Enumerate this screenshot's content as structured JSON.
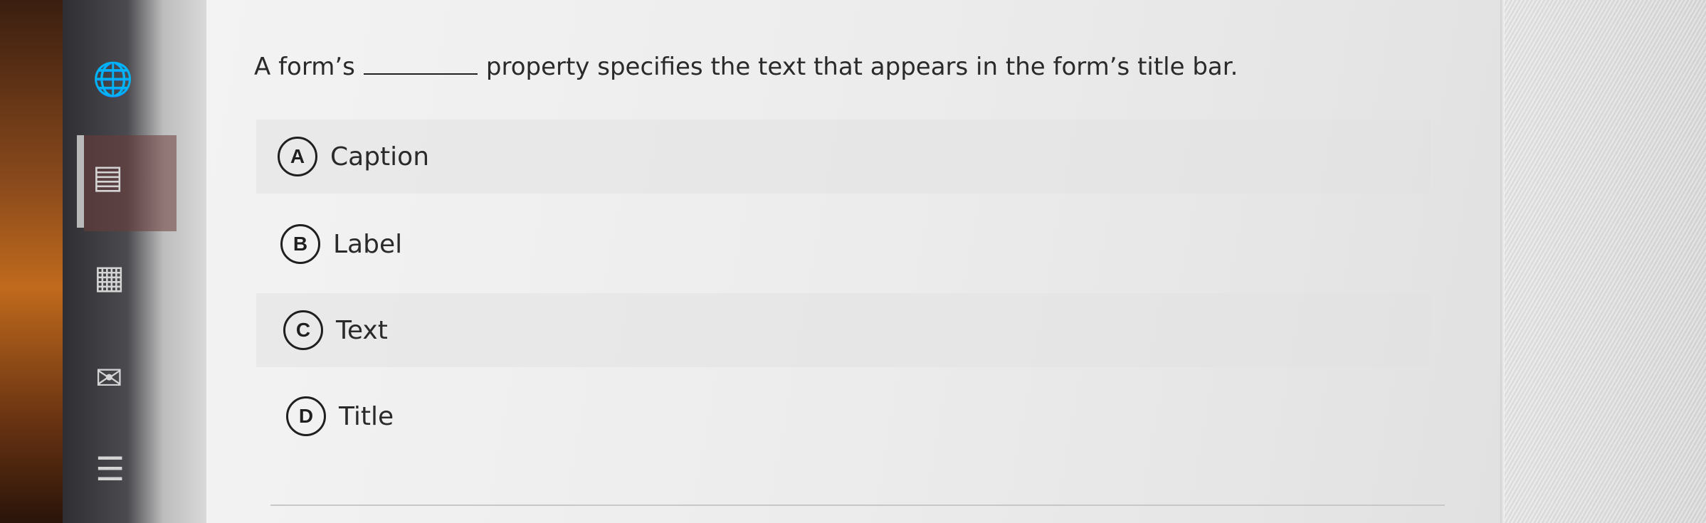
{
  "question": {
    "before_blank": "A form’s",
    "after_blank": "property specifies the text that appears in the form’s title bar."
  },
  "options": [
    {
      "letter": "A",
      "text": "Caption"
    },
    {
      "letter": "B",
      "text": "Label"
    },
    {
      "letter": "C",
      "text": "Text"
    },
    {
      "letter": "D",
      "text": "Title"
    }
  ],
  "sidebar": {
    "icons": [
      "globe-icon",
      "layout-icon",
      "calendar-icon",
      "mail-icon",
      "document-icon"
    ]
  },
  "colors": {
    "text": "#2a2a2a",
    "badge_border": "#1f1f1f",
    "panel": "#eeeeee"
  }
}
